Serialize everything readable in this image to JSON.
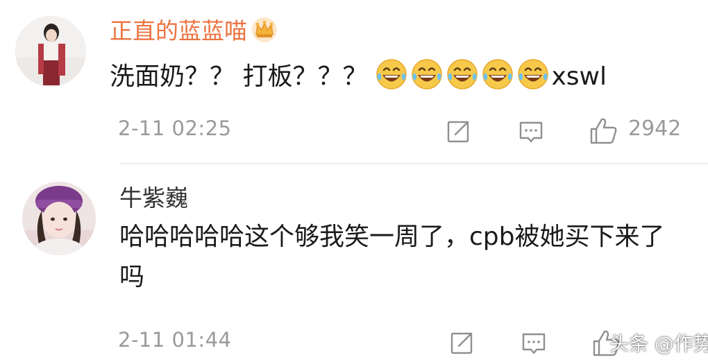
{
  "comments": [
    {
      "username": "正直的蓝蓝喵",
      "text_prefix": "洗面奶？？ 打板？？？",
      "text_suffix": "xswl",
      "emoji_names": [
        "laugh-cry-icon",
        "laugh-cry-icon",
        "laugh-cry-icon",
        "laugh-cry-icon",
        "laugh-cry-icon"
      ],
      "time": "2-11 02:25",
      "like_count": "2942",
      "username_color": "#eb7340"
    },
    {
      "username": "牛紫巍",
      "text": "哈哈哈哈哈这个够我笑一周了，cpb被她买下来了吗",
      "time": "2-11 01:44"
    }
  ],
  "watermark": "头条 @作势",
  "icons": {
    "share": "share-icon",
    "comment": "comment-icon",
    "like": "thumbs-up-icon",
    "badge": "crown-icon"
  }
}
